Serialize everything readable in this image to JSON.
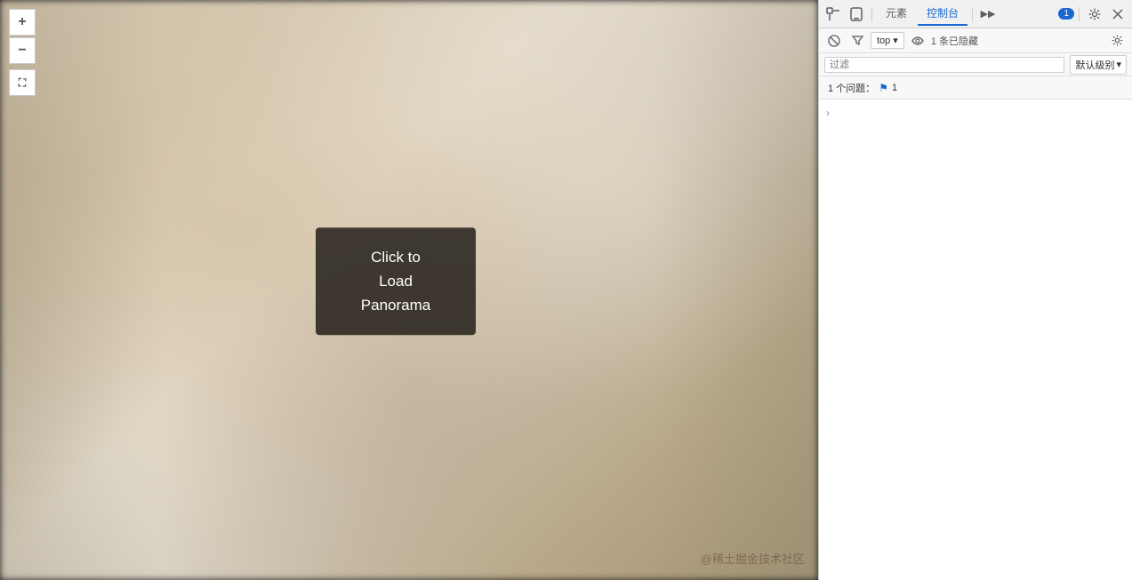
{
  "leftPanel": {
    "loadBtn": {
      "line1": "Click to",
      "line2": "Load",
      "line3": "Panorama",
      "label": "Click to Load Panorama"
    },
    "controls": {
      "zoomIn": "+",
      "zoomOut": "−",
      "fullscreen": "⛶"
    },
    "watermark": "@稀土掘金技术社区"
  },
  "devtools": {
    "tabs": [
      {
        "label": "元素",
        "active": false
      },
      {
        "label": "控制台",
        "active": true
      },
      {
        "label": "▶▶",
        "active": false,
        "isChevron": true
      }
    ],
    "consoleBadge": "1",
    "toolbarIcons": {
      "inspect": "⬚",
      "device": "□",
      "settings": "⚙",
      "close": "✕",
      "screencast": "▭",
      "network": "◉"
    },
    "consoleToolbar": {
      "clear": "🚫",
      "filter": "⊘",
      "context": "top",
      "eye": "👁",
      "hiddenCount": "1 条已隐藏",
      "settings": "⚙"
    },
    "filterRow": {
      "placeholder": "过滤",
      "levelLabel": "默认级别",
      "levelDropdown": "▾"
    },
    "issuesBar": {
      "label": "1 个问题：",
      "count": "1"
    },
    "consoleContent": {
      "expandArrow": "›"
    }
  }
}
